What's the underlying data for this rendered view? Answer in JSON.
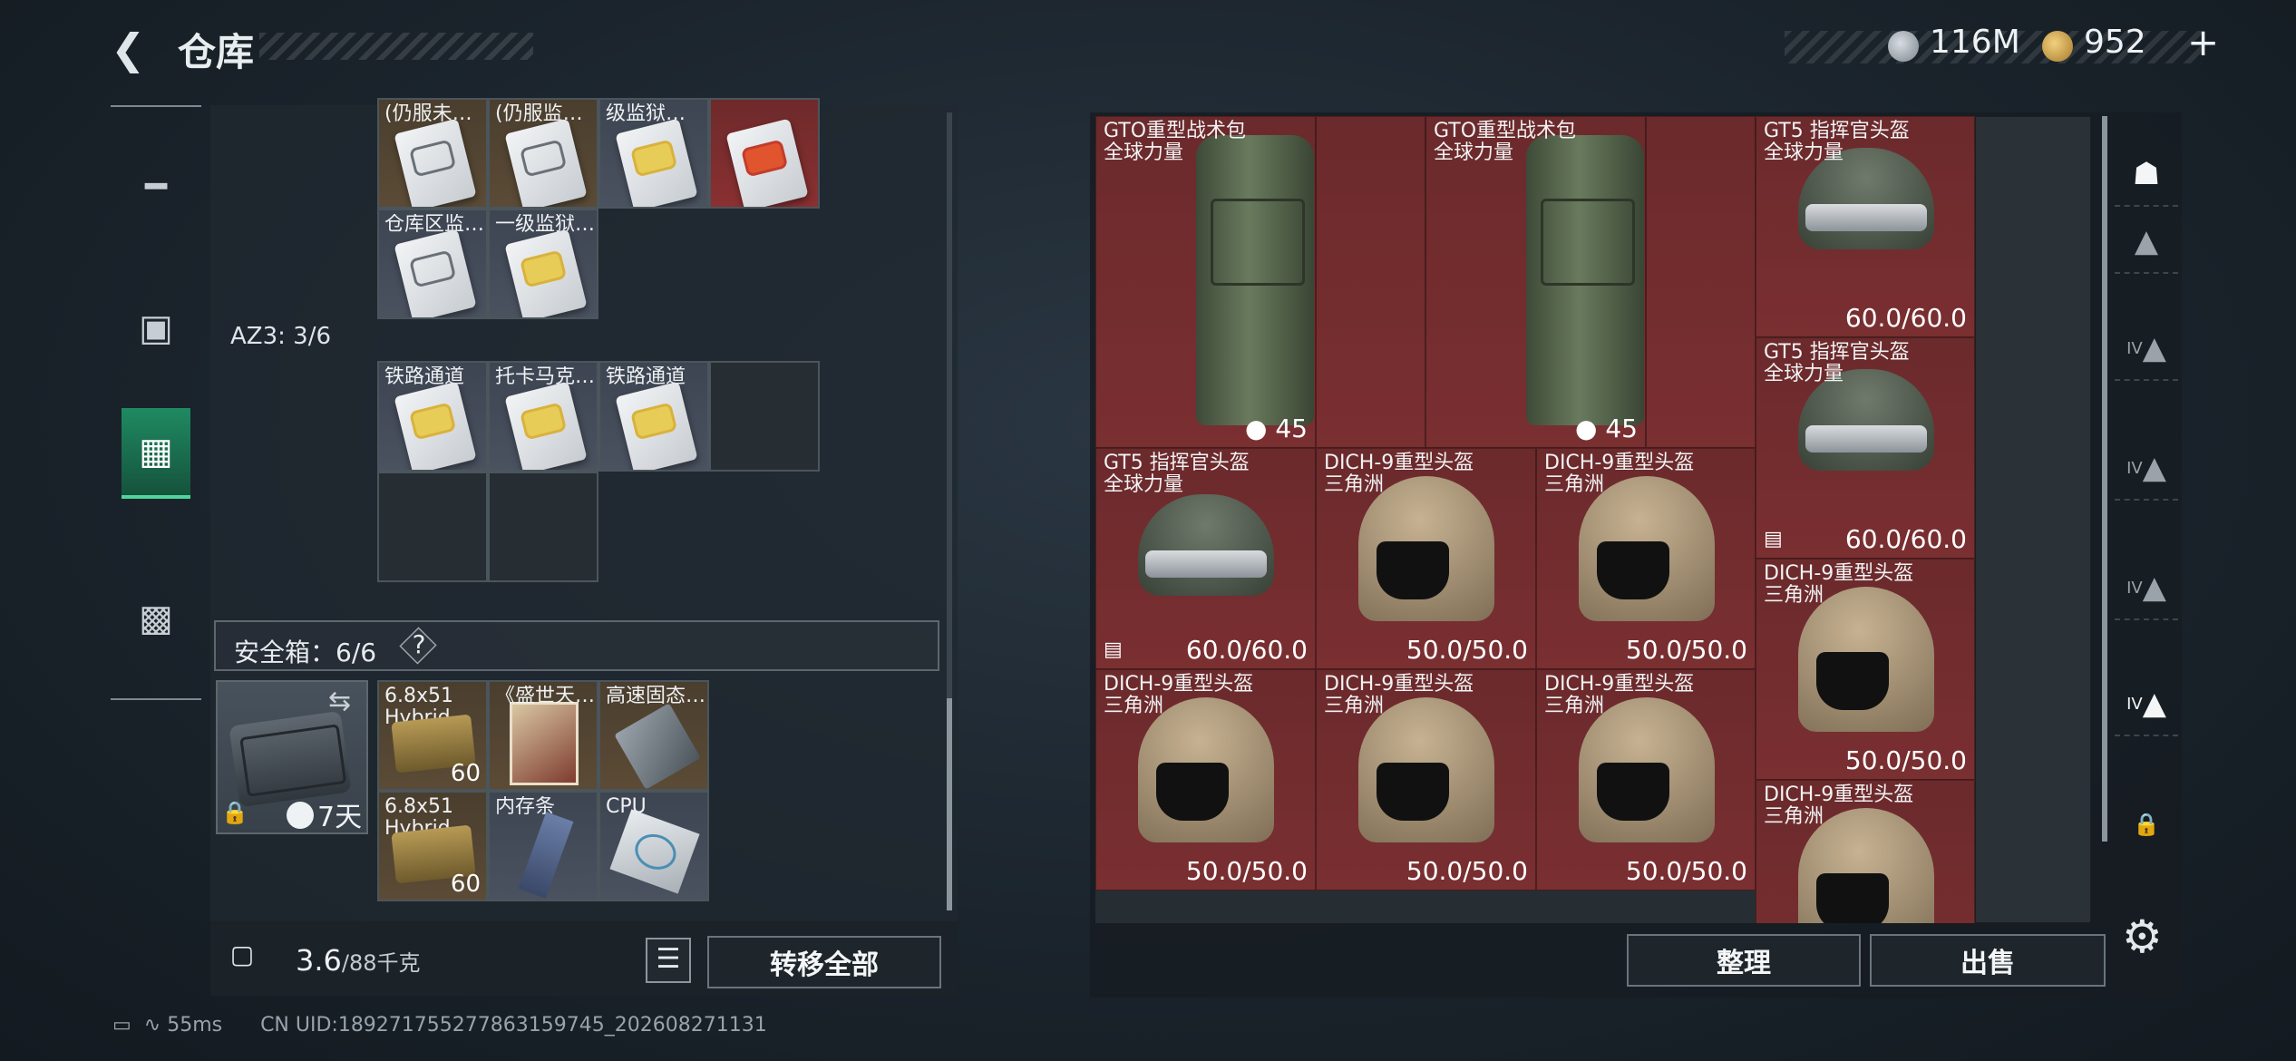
{
  "header": {
    "back_icon": "back-chevron-icon",
    "title": "仓库",
    "currency1": "116M",
    "currency2": "952"
  },
  "left_nav": [
    "gun-icon",
    "backpack-icon",
    "container-icon",
    "briefcase-icon"
  ],
  "storage": {
    "row1": [
      {
        "label": "(仍服未…",
        "color": "gold"
      },
      {
        "label": "(仍服监…",
        "color": "gold"
      },
      {
        "label": "级监狱…",
        "color": "gray"
      },
      {
        "label": "",
        "color": "red"
      }
    ],
    "row2": [
      {
        "label": "仓库区监…",
        "color": "gray"
      },
      {
        "label": "一级监狱…",
        "color": "gray"
      }
    ],
    "az3_label": "AZ3: 3/6",
    "az3": [
      {
        "label": "铁路通道"
      },
      {
        "label": "托卡马克…"
      },
      {
        "label": "铁路通道"
      }
    ]
  },
  "safe": {
    "label": "安全箱：6/6",
    "help": "?",
    "days": "7天",
    "items": [
      {
        "label": "6.8x51",
        "sub": "Hybrid",
        "count": "60"
      },
      {
        "label": "《盛世天…",
        "sub": "",
        "count": ""
      },
      {
        "label": "高速固态…",
        "sub": "",
        "count": ""
      },
      {
        "label": "6.8x51",
        "sub": "Hybrid",
        "count": "60"
      },
      {
        "label": "内存条",
        "sub": "",
        "count": ""
      },
      {
        "label": "CPU",
        "sub": "",
        "count": ""
      }
    ]
  },
  "footer_bar": {
    "weight": "3.6",
    "weight_max": "/88千克",
    "transfer_all": "转移全部"
  },
  "stash": [
    {
      "name": "GTO重型战术包",
      "brand": "全球力量",
      "value": "45"
    },
    {
      "name": "GTO重型战术包",
      "brand": "全球力量",
      "value": "45"
    },
    {
      "name": "GT5 指挥官头盔",
      "brand": "全球力量",
      "value": "60.0/60.0"
    },
    {
      "name": "GT5 指挥官头盔",
      "brand": "全球力量",
      "value": "60.0/60.0"
    },
    {
      "name": "GT5 指挥官头盔",
      "brand": "全球力量",
      "value": "60.0/60.0"
    },
    {
      "name": "DICH-9重型头盔",
      "brand": "三角洲",
      "value": "50.0/50.0"
    },
    {
      "name": "DICH-9重型头盔",
      "brand": "三角洲",
      "value": "50.0/50.0"
    },
    {
      "name": "DICH-9重型头盔",
      "brand": "三角洲",
      "value": "50.0/50.0"
    },
    {
      "name": "DICH-9重型头盔",
      "brand": "三角洲",
      "value": "50.0/50.0"
    },
    {
      "name": "DICH-9重型头盔",
      "brand": "三角洲",
      "value": "50.0/50.0"
    },
    {
      "name": "DICH-9重型头盔",
      "brand": "三角洲",
      "value": "50.0/50.0"
    },
    {
      "name": "DICH-9重型头盔",
      "brand": "三角洲",
      "value": ""
    }
  ],
  "actions": {
    "sort": "整理",
    "sell": "出售"
  },
  "right_nav": [
    "armor-icon",
    "iv-badge-1",
    "iv-badge-2",
    "iv-badge-3",
    "iv-badge-4",
    "iv-badge-5",
    "lock-icon"
  ],
  "right_nav_labels": [
    "IV",
    "IV",
    "IV",
    "IV"
  ],
  "status": {
    "ping": "55ms",
    "uid": "CN UID:189271755277863159745_202608271131"
  }
}
